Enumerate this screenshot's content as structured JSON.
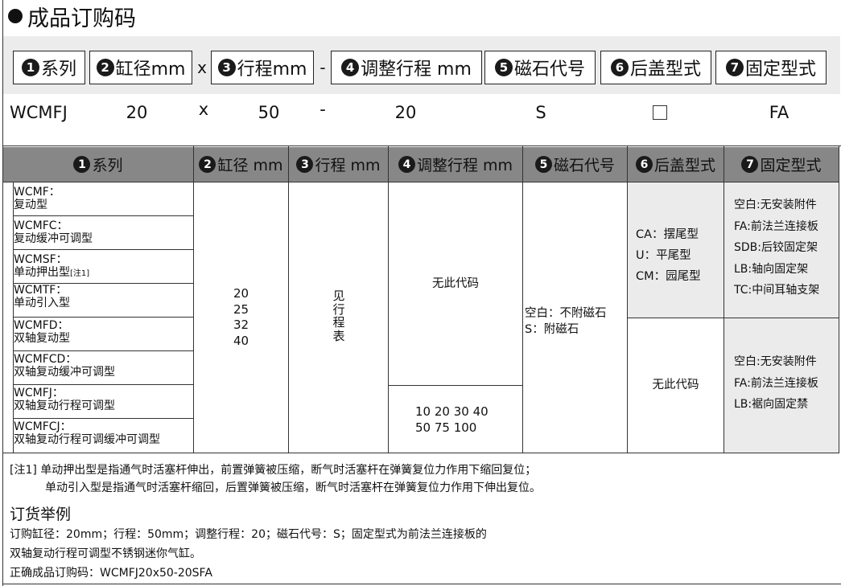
{
  "title": "成品订购码",
  "code_header": {
    "items": [
      {
        "num": "1",
        "label": "系列"
      },
      {
        "num": "2",
        "label": "缸径mm"
      },
      {
        "num": "3",
        "label": "行程mm"
      },
      {
        "num": "4",
        "label": "调整行程 mm"
      },
      {
        "num": "5",
        "label": "磁石代号"
      },
      {
        "num": "6",
        "label": "后盖型式"
      },
      {
        "num": "7",
        "label": "固定型式"
      }
    ],
    "sep_x": "x",
    "sep_dash": "-"
  },
  "code_values": {
    "series": "WCMFJ",
    "bore": "20",
    "x": "x",
    "stroke": "50",
    "dash": "-",
    "adjust": "20",
    "magnet": "S",
    "fixing": "FA"
  },
  "table": {
    "headers": [
      {
        "num": "1",
        "label": "系列"
      },
      {
        "num": "2",
        "label": "缸径 mm"
      },
      {
        "num": "3",
        "label": "行程 mm"
      },
      {
        "num": "4",
        "label": "调整行程 mm"
      },
      {
        "num": "5",
        "label": "磁石代号"
      },
      {
        "num": "6",
        "label": "后盖型式"
      },
      {
        "num": "7",
        "label": "固定型式"
      }
    ],
    "series": [
      {
        "code": "WCMF：",
        "desc": "复动型",
        "note": ""
      },
      {
        "code": "WCMFC：",
        "desc": "复动缓冲可调型",
        "note": ""
      },
      {
        "code": "WCMSF：",
        "desc": "单动押出型",
        "note": "[注1]"
      },
      {
        "code": "WCMTF：",
        "desc": "单动引入型",
        "note": ""
      },
      {
        "code": "WCMFD：",
        "desc": "双轴复动型",
        "note": ""
      },
      {
        "code": "WCMFCD：",
        "desc": "双轴复动缓冲可调型",
        "note": ""
      },
      {
        "code": "WCMFJ：",
        "desc": "双轴复动行程可调型",
        "note": ""
      },
      {
        "code": "WCMFCJ：",
        "desc": "双轴复动行程可调缓冲可调型",
        "note": ""
      }
    ],
    "bores": [
      "20",
      "25",
      "32",
      "40"
    ],
    "stroke_note": [
      "见",
      "行",
      "程",
      "表"
    ],
    "adjust_none": "无此代码",
    "adjust_values": [
      "10 20 30 40",
      "50 75 100"
    ],
    "magnet": [
      "空白：不附磁石",
      "S：附磁石"
    ],
    "rear_cover": [
      "CA：摆尾型",
      "U：平尾型",
      "CM：园尾型"
    ],
    "rear_cover_none": "无此代码",
    "fixing_upper": [
      "空白:无安装附件",
      "FA:前法兰连接板",
      "SDB:后铰固定架",
      "LB:轴向固定架",
      "TC:中间耳轴支架"
    ],
    "fixing_lower": [
      "空白:无安装附件",
      "FA:前法兰连接板",
      "LB:裾向固定禁"
    ]
  },
  "notes": {
    "line1": "[注1]  单动押出型是指通气时活塞杆伸出，前置弹簧被压缩，断气时活塞杆在弹簧复位力作用下缩回复位；",
    "line2": "单动引入型是指通气时活塞杆缩回，后置弹簧被压缩，断气时活塞杆在弹簧复位力作用下伸出复位。"
  },
  "example": {
    "title": "订货举例",
    "line1": "订购缸径：20mm；行程：50mm；调整行程：20；磁石代号：S；固定型式为前法兰连接板的",
    "line2": "双轴复动行程可调型不锈钢迷你气缸。",
    "line3": "正确成品订购码：WCMFJ20x50-20SFA"
  }
}
